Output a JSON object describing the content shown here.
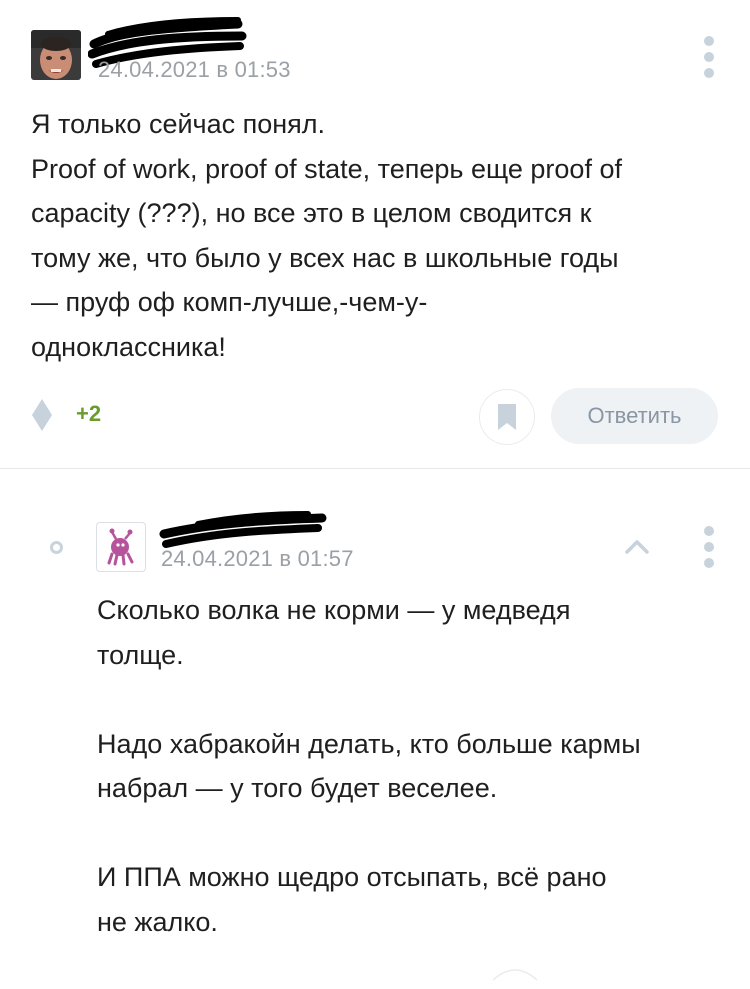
{
  "comments": [
    {
      "date": "24.04.2021 в 01:53",
      "body_lines": [
        "Я только сейчас понял.",
        "Proof of work, proof of state, теперь еще proof of",
        "capacity (???), но все это в целом сводится к",
        "тому же, что было у всех нас в школьные годы",
        "— пруф оф комп-лучше,-чем-у-",
        "одноклассника!"
      ],
      "rating": "+2",
      "reply_label": "Ответить"
    },
    {
      "date": "24.04.2021 в 01:57",
      "paragraphs": [
        [
          "Сколько волка не корми — у медведя",
          "толще."
        ],
        [
          "Надо хабракойн делать, кто больше кармы",
          "набрал — у того будет веселее."
        ],
        [
          "И ППА можно щедро отсыпать, всё рано",
          "не жалко."
        ]
      ]
    }
  ],
  "colors": {
    "rating_positive": "#6b9b2e",
    "meta_gray": "#9aa0a6",
    "icon_gray": "#c7d2dc",
    "reply_bg": "#eef2f5"
  }
}
